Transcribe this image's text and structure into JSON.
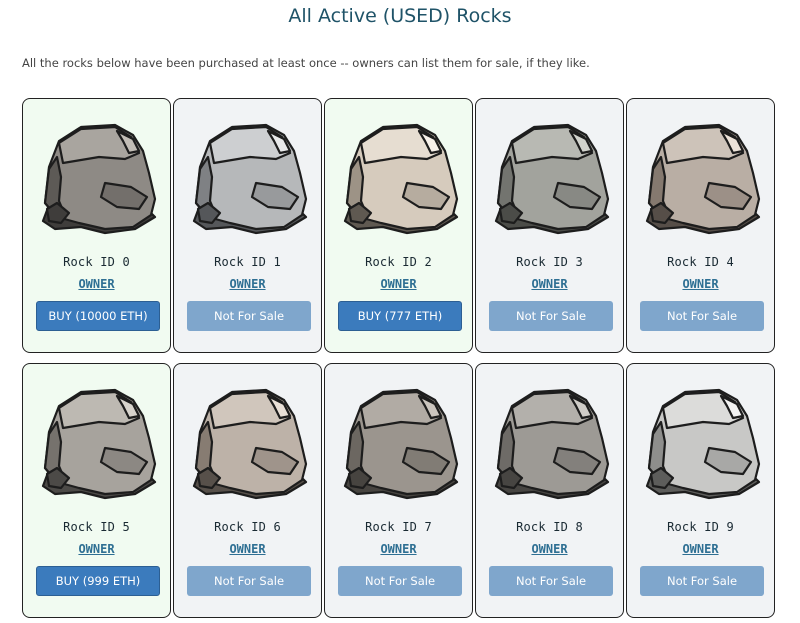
{
  "title": "All Active (USED) Rocks",
  "intro": "All the rocks below have been purchased at least once -- owners can list them for sale, if they like.",
  "colors": {
    "title": "#1f5368",
    "owner_link": "#2e6f93",
    "buy_button": "#3b7bbd",
    "not_for_sale_button": "#7fa6cc",
    "for_sale_card_bg": "#f1fbf1",
    "card_bg": "#f1f3f5"
  },
  "rocks": [
    {
      "id_label": "Rock ID 0",
      "owner_label": "OWNER",
      "button_label": "BUY (10000 ETH)",
      "for_sale": true,
      "icon": "rock-icon",
      "tone": {
        "base": "#8e8a85",
        "light": "#a9a59f",
        "dark": "#5d5a56",
        "shadow": "#3f3d3b",
        "hi": "#c2bdb6"
      }
    },
    {
      "id_label": "Rock ID 1",
      "owner_label": "OWNER",
      "button_label": "Not For Sale",
      "for_sale": false,
      "icon": "rock-icon",
      "tone": {
        "base": "#b6b8ba",
        "light": "#cdcfd1",
        "dark": "#7f8184",
        "shadow": "#55575a",
        "hi": "#e8e9ea"
      }
    },
    {
      "id_label": "Rock ID 2",
      "owner_label": "OWNER",
      "button_label": "BUY (777 ETH)",
      "for_sale": true,
      "icon": "rock-icon",
      "tone": {
        "base": "#d6cbbd",
        "light": "#e6ddd1",
        "dark": "#9d9386",
        "shadow": "#5f5951",
        "hi": "#f7f1ea"
      }
    },
    {
      "id_label": "Rock ID 3",
      "owner_label": "OWNER",
      "button_label": "Not For Sale",
      "for_sale": false,
      "icon": "rock-icon",
      "tone": {
        "base": "#a2a39d",
        "light": "#b8b9b3",
        "dark": "#73746f",
        "shadow": "#4b4c48",
        "hi": "#d2d3cd"
      }
    },
    {
      "id_label": "Rock ID 4",
      "owner_label": "OWNER",
      "button_label": "Not For Sale",
      "for_sale": false,
      "icon": "rock-icon",
      "tone": {
        "base": "#b9aea4",
        "light": "#cdc3b9",
        "dark": "#85796f",
        "shadow": "#564e48",
        "hi": "#ece2d8"
      }
    },
    {
      "id_label": "Rock ID 5",
      "owner_label": "OWNER",
      "button_label": "BUY (999 ETH)",
      "for_sale": true,
      "icon": "rock-icon",
      "tone": {
        "base": "#a7a39d",
        "light": "#bdb9b2",
        "dark": "#76726d",
        "shadow": "#4c4a47",
        "hi": "#d7d3cc"
      }
    },
    {
      "id_label": "Rock ID 6",
      "owner_label": "OWNER",
      "button_label": "Not For Sale",
      "for_sale": false,
      "icon": "rock-icon",
      "tone": {
        "base": "#bdb2a8",
        "light": "#d0c6bc",
        "dark": "#877c72",
        "shadow": "#57504a",
        "hi": "#e9e0d7"
      }
    },
    {
      "id_label": "Rock ID 7",
      "owner_label": "OWNER",
      "button_label": "Not For Sale",
      "for_sale": false,
      "icon": "rock-icon",
      "tone": {
        "base": "#9b958e",
        "light": "#b1aba4",
        "dark": "#6c6761",
        "shadow": "#474440",
        "hi": "#cbc5be"
      }
    },
    {
      "id_label": "Rock ID 8",
      "owner_label": "OWNER",
      "button_label": "Not For Sale",
      "for_sale": false,
      "icon": "rock-icon",
      "tone": {
        "base": "#9d9a95",
        "light": "#b3b0ab",
        "dark": "#6e6b67",
        "shadow": "#474542",
        "hi": "#cfccc7"
      }
    },
    {
      "id_label": "Rock ID 9",
      "owner_label": "OWNER",
      "button_label": "Not For Sale",
      "for_sale": false,
      "icon": "rock-icon",
      "tone": {
        "base": "#c8c8c6",
        "light": "#dcdcda",
        "dark": "#8e8e8c",
        "shadow": "#5d5d5b",
        "hi": "#f3f3f2"
      }
    }
  ]
}
